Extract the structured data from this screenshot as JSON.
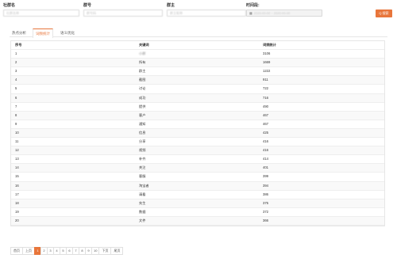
{
  "filters": {
    "group_name_label": "社群名",
    "group_name_value": "社群名称",
    "group_id_label": "群号",
    "group_id_value": "群号码",
    "owner_label": "群主",
    "owner_value": "群主昵称",
    "time_label": "时间段:",
    "time_value": "2020-00-00 ~ 2020-00-00",
    "search_label": "Q 搜索"
  },
  "tabs": [
    {
      "label": "热点分析"
    },
    {
      "label": "词频统计"
    },
    {
      "label": "语义优化"
    }
  ],
  "table": {
    "headers": {
      "index": "序号",
      "keyword": "关键词",
      "count": "词频统计"
    },
    "rows": [
      {
        "index": "1",
        "keyword": "小群",
        "count": "3106"
      },
      {
        "index": "2",
        "keyword": "所有",
        "count": "1669"
      },
      {
        "index": "3",
        "keyword": "群主",
        "count": "1222"
      },
      {
        "index": "4",
        "keyword": "截图",
        "count": "911"
      },
      {
        "index": "5",
        "keyword": "讨论",
        "count": "722"
      },
      {
        "index": "6",
        "keyword": "成功",
        "count": "716"
      },
      {
        "index": "7",
        "keyword": "提供",
        "count": "490"
      },
      {
        "index": "8",
        "keyword": "客户",
        "count": "467"
      },
      {
        "index": "9",
        "keyword": "通知",
        "count": "467"
      },
      {
        "index": "10",
        "keyword": "信息",
        "count": "425"
      },
      {
        "index": "11",
        "keyword": "分享",
        "count": "416"
      },
      {
        "index": "12",
        "keyword": "视频",
        "count": "416"
      },
      {
        "index": "13",
        "keyword": "补齐",
        "count": "414"
      },
      {
        "index": "14",
        "keyword": "关注",
        "count": "401"
      },
      {
        "index": "15",
        "keyword": "客服",
        "count": "399"
      },
      {
        "index": "16",
        "keyword": "淘宝者",
        "count": "394"
      },
      {
        "index": "17",
        "keyword": "请看",
        "count": "386"
      },
      {
        "index": "18",
        "keyword": "先生",
        "count": "375"
      },
      {
        "index": "19",
        "keyword": "数据",
        "count": "372"
      },
      {
        "index": "20",
        "keyword": "文件",
        "count": "366"
      }
    ]
  },
  "pager": {
    "first": "首页",
    "prev": "上页",
    "pages": [
      "1",
      "2",
      "3",
      "4",
      "5",
      "6",
      "7",
      "8",
      "9",
      "10"
    ],
    "current": "1",
    "next": "下页",
    "last": "尾页"
  },
  "colors": {
    "accent": "#e8763b",
    "border": "#e6e6e6",
    "row_alt": "#f9f9f9"
  }
}
